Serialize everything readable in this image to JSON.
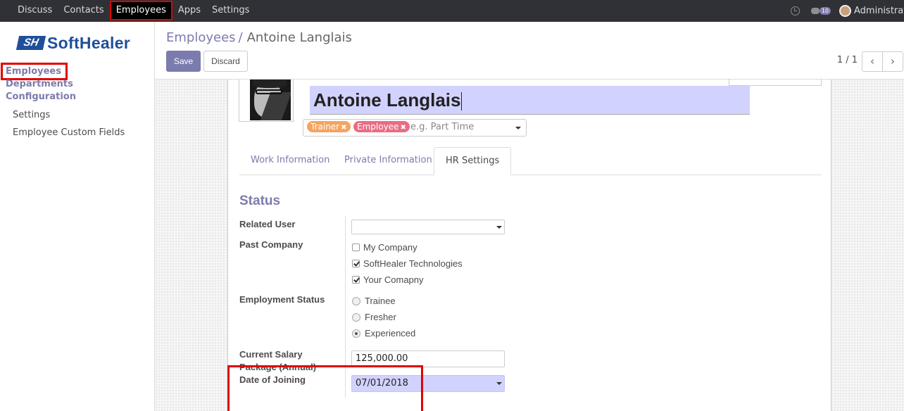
{
  "topbar": {
    "menu": [
      "Discuss",
      "Contacts",
      "Employees",
      "Apps",
      "Settings"
    ],
    "active": "Employees",
    "chat_count": "10",
    "user": "Administrator"
  },
  "brand": {
    "mark": "SH",
    "name": "SoftHealer"
  },
  "sidebar": {
    "items": [
      "Employees",
      "Departments",
      "Configuration"
    ],
    "config_items": [
      "Settings",
      "Employee Custom Fields"
    ]
  },
  "control_panel": {
    "breadcrumb_parent": "Employees",
    "breadcrumb_sep": "/",
    "breadcrumb_current": "Antoine Langlais",
    "save_label": "Save",
    "discard_label": "Discard",
    "pager": "1 / 1"
  },
  "employee": {
    "name": "Antoine Langlais",
    "tags": [
      "Trainer",
      "Employee"
    ],
    "tags_placeholder": "e.g. Part Time"
  },
  "tabs": [
    "Work Information",
    "Private Information",
    "HR Settings"
  ],
  "active_tab": "HR Settings",
  "status": {
    "title": "Status",
    "related_user_label": "Related User",
    "related_user_value": "",
    "past_company_label": "Past Company",
    "companies": [
      {
        "label": "My Company",
        "checked": false
      },
      {
        "label": "SoftHealer Technologies",
        "checked": true
      },
      {
        "label": "Your Comapny",
        "checked": true
      }
    ],
    "employment_status_label": "Employment Status",
    "employment_options": [
      "Trainee",
      "Fresher",
      "Experienced"
    ],
    "employment_selected": "Experienced",
    "salary_label_1": "Current Salary",
    "salary_label_2": "Package (Annual)",
    "salary_value": "125,000.00",
    "joining_label": "Date of Joining",
    "joining_value": "07/01/2018"
  },
  "colors": {
    "accent": "#7c7bad",
    "annotation": "#e00000",
    "topbar": "#2f3136",
    "tag_trainer": "#f4a460",
    "tag_employee": "#e96c83"
  }
}
